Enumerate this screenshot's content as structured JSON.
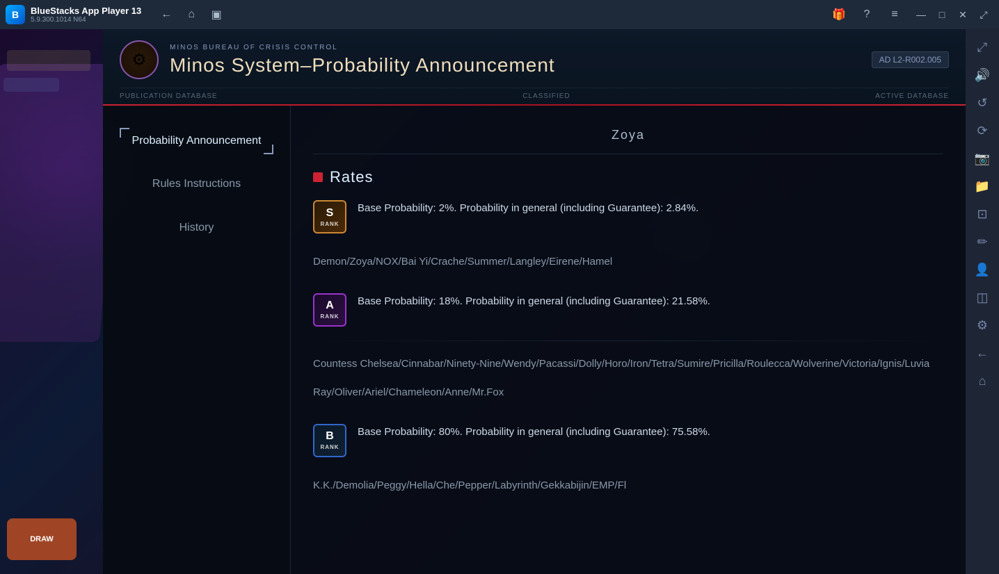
{
  "titlebar": {
    "app_name": "BlueStacks App Player 13",
    "version": "5.9.300.1014  N64",
    "back_btn": "←",
    "home_btn": "⌂",
    "tabs_btn": "▣",
    "gift_icon": "🎁",
    "help_icon": "?",
    "menu_icon": "≡",
    "minimize_icon": "—",
    "maximize_icon": "□",
    "close_icon": "✕",
    "expand_icon": "⤢"
  },
  "right_sidebar": {
    "buttons": [
      {
        "name": "expand-sidebar-btn",
        "icon": "⤢",
        "label": "expand"
      },
      {
        "name": "volume-btn",
        "icon": "🔊",
        "label": "volume"
      },
      {
        "name": "replay-btn",
        "icon": "↺",
        "label": "replay"
      },
      {
        "name": "rotate-btn",
        "icon": "⟳",
        "label": "rotate"
      },
      {
        "name": "screenshot-btn",
        "icon": "📷",
        "label": "screenshot"
      },
      {
        "name": "folder-btn",
        "icon": "📁",
        "label": "folder"
      },
      {
        "name": "resize-btn",
        "icon": "⊡",
        "label": "resize"
      },
      {
        "name": "edit-btn",
        "icon": "✏",
        "label": "edit"
      },
      {
        "name": "profile-btn",
        "icon": "👤",
        "label": "profile"
      },
      {
        "name": "layers-btn",
        "icon": "◫",
        "label": "layers"
      },
      {
        "name": "settings-btn",
        "icon": "⚙",
        "label": "settings"
      },
      {
        "name": "back-arrow-btn",
        "icon": "←",
        "label": "back"
      },
      {
        "name": "home-bs-btn",
        "icon": "⌂",
        "label": "home"
      }
    ]
  },
  "header": {
    "org_name": "MINOS BUREAU OF CRISIS CONTROL",
    "title": "Minos System–Probability Announcement",
    "doc_id": "AD  L2-R002.005",
    "meta_left": "PUBLICATION DATABASE",
    "meta_center": "CLASSIFIED",
    "meta_right": "ACTIVE DATABASE"
  },
  "nav": {
    "items": [
      {
        "id": "probability",
        "label": "Probability\nAnnouncement",
        "active": true
      },
      {
        "id": "rules",
        "label": "Rules\nInstructions",
        "active": false
      },
      {
        "id": "history",
        "label": "History",
        "active": false
      }
    ]
  },
  "content": {
    "char_name": "Zoya",
    "section_title": "Rates",
    "rates": [
      {
        "rank": "S",
        "rank_sub": "RANK",
        "rank_type": "s-rank",
        "description": "Base Probability: 2%. Probability in general (including Guarantee): 2.84%.",
        "characters": ""
      },
      {
        "rank": "A",
        "rank_sub": "RANK",
        "rank_type": "a-rank",
        "description": "Base Probability: 18%. Probability in general (including Guarantee): 21.58%.",
        "characters": "Demon/Zoya/NOX/Bai Yi/Crache/Summer/Langley/Eirene/Hamel"
      },
      {
        "rank": "B",
        "rank_sub": "RANK",
        "rank_type": "b-rank",
        "description": "Base Probability: 80%. Probability in general (including Guarantee): 75.58%.",
        "characters_line1": "Countess Chelsea/Cinnabar/Ninety-Nine/Wendy/Pacassi/Dolly/Horo/Iron/Tetra/Sumire/Pricilla/Roulecca/Wolverine/Victoria/Ignis/Luvia",
        "characters_line2": "Ray/Oliver/Ariel/Chameleon/Anne/Mr.Fox",
        "characters_bottom": "K.K./Demolia/Peggy/Hella/Che/Pepper/Labyrinth/Gekkabijin/EMP/Fl"
      }
    ]
  },
  "game_left": {
    "orange_btn_text": "DRAW"
  }
}
